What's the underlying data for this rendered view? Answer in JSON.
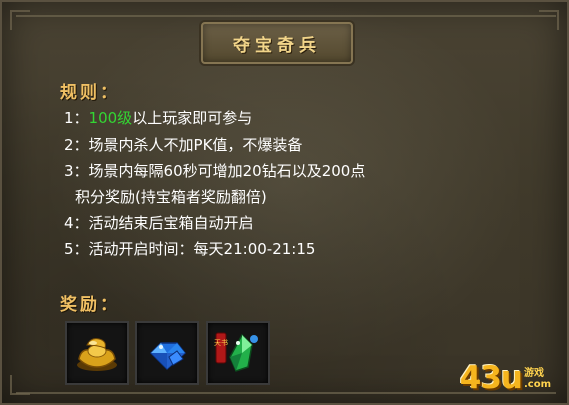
{
  "title": "夺宝奇兵",
  "rules_label": "规则：",
  "rules": [
    {
      "num": "1：",
      "highlight": "100级",
      "text": "以上玩家即可参与"
    },
    {
      "num": "2：",
      "text": "场景内杀人不加PK值，不爆装备"
    },
    {
      "num": "3：",
      "text": "场景内每隔60秒可增加20钻石以及200点"
    },
    {
      "num": "",
      "text": "积分奖励(持宝箱者奖励翻倍)"
    },
    {
      "num": "4：",
      "text": "活动结束后宝箱自动开启"
    },
    {
      "num": "5：",
      "text": "活动开启时间：每天21:00-21:15"
    }
  ],
  "rewards_label": "奖励：",
  "rewards": [
    {
      "icon": "gold-ingot-icon"
    },
    {
      "icon": "blue-diamond-icon"
    },
    {
      "icon": "green-gem-scroll-icon",
      "tag": "天书"
    }
  ],
  "watermark": {
    "main": "43u",
    "top": "游戏",
    "bottom": ".com"
  },
  "colors": {
    "highlight": "#33d633",
    "label": "#f0c064",
    "title": "#f2d58a"
  }
}
